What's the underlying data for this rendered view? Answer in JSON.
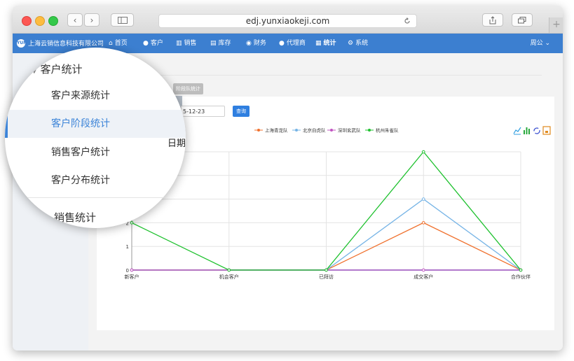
{
  "browser": {
    "url": "edj.yunxiaokeji.com",
    "nav_back": "‹",
    "nav_forward": "›",
    "new_tab": "+"
  },
  "nav": {
    "brand": "上海云销信息科技有限公司",
    "logo_text": "YUN",
    "items": [
      {
        "label": "首页",
        "icon": "home-icon"
      },
      {
        "label": "客户",
        "icon": "user-icon"
      },
      {
        "label": "销售",
        "icon": "bar-chart-icon"
      },
      {
        "label": "库存",
        "icon": "warehouse-icon"
      },
      {
        "label": "财务",
        "icon": "money-bag-icon"
      },
      {
        "label": "代理商",
        "icon": "users-icon"
      },
      {
        "label": "统计",
        "icon": "stats-icon"
      },
      {
        "label": "系统",
        "icon": "gear-icon"
      }
    ],
    "active_item": "统计",
    "user": "周公"
  },
  "page": {
    "breadcrumb_char": "客",
    "tab_label": "阶段队统计",
    "stamp_label": "客",
    "date_value": "5-12-23",
    "query_button": "查询"
  },
  "magnifier": {
    "header": "客户统计",
    "items": [
      {
        "label": "客户来源统计",
        "selected": false
      },
      {
        "label": "客户阶段统计",
        "selected": true
      },
      {
        "label": "销售客户统计",
        "selected": false
      },
      {
        "label": "客户分布统计",
        "selected": false
      }
    ],
    "footer": "销售统计",
    "partial_text": "日期"
  },
  "chart_data": {
    "type": "line",
    "categories": [
      "新客户",
      "机会客户",
      "已拜访",
      "成交客户",
      "合作伙伴"
    ],
    "series": [
      {
        "name": "上海青龙队",
        "color": "#f0712e",
        "marker": "circle",
        "values": [
          0,
          0,
          0,
          2,
          0
        ]
      },
      {
        "name": "北京白虎队",
        "color": "#76b4e6",
        "marker": "square",
        "values": [
          0,
          0,
          0,
          3,
          0
        ]
      },
      {
        "name": "深圳玄武队",
        "color": "#c154c1",
        "marker": "triangle",
        "values": [
          0,
          0,
          0,
          0,
          0
        ]
      },
      {
        "name": "杭州朱雀队",
        "color": "#1ec12e",
        "marker": "diamond",
        "values": [
          2,
          0,
          0,
          5,
          0
        ]
      }
    ],
    "yticks": [
      0,
      1,
      2
    ],
    "ylim": [
      0,
      5
    ],
    "grid": true,
    "legend": "top-center",
    "tools": [
      "line-chart-icon",
      "bar-chart-icon",
      "refresh-icon",
      "save-icon"
    ]
  }
}
